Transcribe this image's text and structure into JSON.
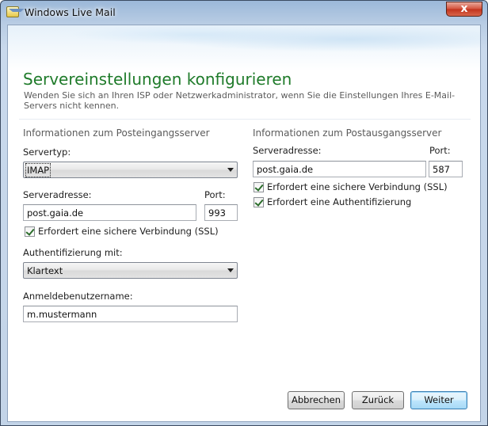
{
  "window": {
    "title": "Windows Live Mail",
    "close_label": "x"
  },
  "header": {
    "title": "Servereinstellungen konfigurieren",
    "description": "Wenden Sie sich an Ihren ISP oder Netzwerkadministrator, wenn Sie die Einstellungen Ihres E-Mail-Servers nicht kennen."
  },
  "incoming": {
    "section_title": "Informationen zum Posteingangsserver",
    "server_type_label": "Servertyp:",
    "server_type_value": "IMAP",
    "server_address_label": "Serveradresse:",
    "server_address_value": "post.gaia.de",
    "port_label": "Port:",
    "port_value": "993",
    "ssl_label": "Erfordert eine sichere Verbindung (SSL)",
    "ssl_checked": true,
    "auth_label": "Authentifizierung mit:",
    "auth_value": "Klartext",
    "username_label": "Anmeldebenutzername:",
    "username_value": "m.mustermann"
  },
  "outgoing": {
    "section_title": "Informationen zum Postausgangsserver",
    "server_address_label": "Serveradresse:",
    "server_address_value": "post.gaia.de",
    "port_label": "Port:",
    "port_value": "587",
    "ssl_label": "Erfordert eine sichere Verbindung (SSL)",
    "ssl_checked": true,
    "auth_required_label": "Erfordert eine Authentifizierung",
    "auth_required_checked": true
  },
  "footer": {
    "cancel_label": "Abbrechen",
    "back_label": "Zurück",
    "next_label": "Weiter"
  },
  "colors": {
    "title_green": "#1f7b2a",
    "accent_blue": "#3c7fb1"
  }
}
